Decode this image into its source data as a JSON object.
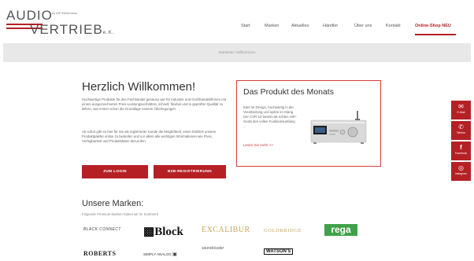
{
  "logo": {
    "audio": "AUDIO",
    "tagline": "by AIF Electronics",
    "vertrieb": "VERTRIEB",
    "kg": "e.K."
  },
  "nav": {
    "items": [
      "Start",
      "Marken",
      "Aktuelles",
      "Händler",
      "Über uns",
      "Kontakt"
    ],
    "shop": "Online-Shop NEU"
  },
  "breadcrumb": "Startseite / Willkommen",
  "welcome": {
    "title": "Herzlich Willkommen!",
    "intro": "Hochwertige Produkte für den Fachhandel genauso wie für Industrie und Großhandelsfirmen mit einem ausgezeichneten Preis-Leistungsverhältnis, schnell, flexibel und in geprüfter Qualität zu liefern, war immer schon die Grundlage unserer Überlegungen.",
    "intro2": "Ab sofort gibt es hier für Sie als registrierter Kunde die Möglichkeit, einen Einblick unserer Produktpalette online zu bestellen und vor allem alle wichtigen Informationen wie Preis, Verfügbarkeit und Produktdaten abzurufen.",
    "login_button": "ZUM LOGIN",
    "b2b_button": "B2B-REGISTRIERUNG"
  },
  "product_of_month": {
    "title": "Das Produkt des Monats",
    "text": "Edel im Design, hochwertig in der Verarbeitung und spitze im Klang. Der CVR-10 besitzt als echtes HiFi-Gerät den vollen Funktionsumfang ...",
    "link": "Lesen Sie mehr >>"
  },
  "brands": {
    "title": "Unsere Marken:",
    "subtitle": "Folgende Premium Marken haben wir im Sortiment",
    "items": [
      "BLACK CONNECT",
      "Block",
      "EXCALIBUR",
      "GOLDBRIDGE",
      "rega",
      "ROBERTS",
      "SIMPLY ANALOG",
      "soundcluster",
      "WATSON'S"
    ]
  },
  "side_buttons": [
    "E-Mail",
    "Telefon",
    "Facebook",
    "Instagram"
  ],
  "colors": {
    "accent": "#b52025",
    "box_border": "#d63d3d",
    "rega": "#3fa24a",
    "gold": "#c9a55a"
  }
}
